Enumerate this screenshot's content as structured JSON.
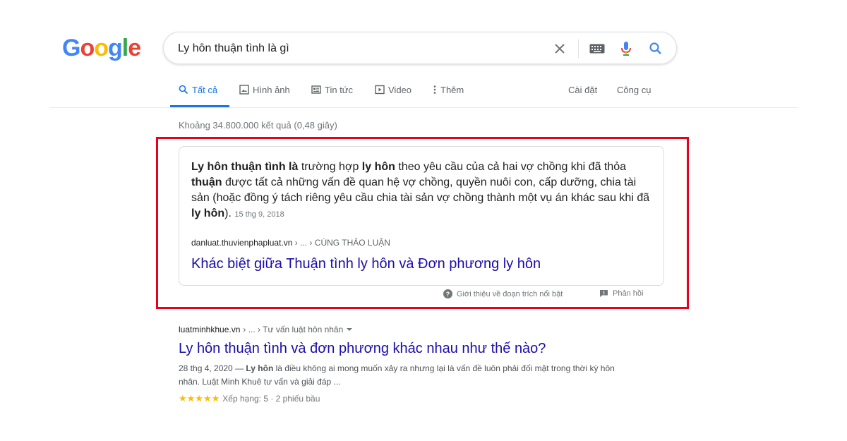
{
  "logo": {
    "letters": [
      "G",
      "o",
      "o",
      "g",
      "l",
      "e"
    ],
    "colors": [
      "#4285f4",
      "#ea4335",
      "#fbbc05",
      "#4285f4",
      "#34a853",
      "#ea4335"
    ]
  },
  "search": {
    "query": "Ly hôn thuận tình là gì",
    "icons": [
      "close-icon",
      "keyboard-icon",
      "microphone-icon",
      "search-icon"
    ]
  },
  "tabs": [
    {
      "label": "Tất cả",
      "icon": "search-icon",
      "active": true
    },
    {
      "label": "Hình ảnh",
      "icon": "image-icon",
      "active": false
    },
    {
      "label": "Tin tức",
      "icon": "news-icon",
      "active": false
    },
    {
      "label": "Video",
      "icon": "video-icon",
      "active": false
    },
    {
      "label": "Thêm",
      "icon": "more-vertical-icon",
      "active": false
    },
    {
      "label": "Cài đặt",
      "icon": "",
      "active": false
    },
    {
      "label": "Công cụ",
      "icon": "",
      "active": false
    }
  ],
  "result_stats": "Khoảng 34.800.000 kết quả (0,48 giây)",
  "featured": {
    "text_parts": [
      {
        "t": "Ly hôn thuận tình là",
        "b": true
      },
      {
        "t": " trường hợp ",
        "b": false
      },
      {
        "t": "ly hôn",
        "b": true
      },
      {
        "t": " theo yêu cầu của cả hai vợ chồng khi đã thỏa ",
        "b": false
      },
      {
        "t": "thuận",
        "b": true
      },
      {
        "t": " được tất cả những vấn đề quan hệ vợ chồng, quyền nuôi con, cấp dưỡng, chia tài sản (hoặc đồng ý tách riêng yêu cầu chia tài sản vợ chồng thành một vụ án khác sau khi đã ",
        "b": false
      },
      {
        "t": "ly hôn",
        "b": true
      },
      {
        "t": ").",
        "b": false
      }
    ],
    "date": "15 thg 9, 2018",
    "cite_domain": "danluat.thuvienphapluat.vn",
    "cite_path": " › ... › CÙNG THẢO LUẬN",
    "title": "Khác biệt giữa Thuận tình ly hôn và Đơn phương ly hôn",
    "footer_about": "Giới thiệu về đoạn trích nổi bật",
    "footer_feedback": "Phản hồi"
  },
  "result2": {
    "cite_domain": "luatminhkhue.vn",
    "cite_path": " › ... › Tư vấn luật hôn nhân",
    "title": "Ly hôn thuận tình và đơn phương khác nhau như thế nào?",
    "snippet_parts": [
      {
        "t": "28 thg 4, 2020 — ",
        "b": false
      },
      {
        "t": "Ly hôn",
        "b": true
      },
      {
        "t": " là điều không ai mong muốn xảy ra nhưng lại là vấn đề luôn phải đối mặt trong thời kỳ hôn nhân. Luật Minh Khuê tư vấn và giải đáp ...",
        "b": false
      }
    ],
    "stars": "★★★★★",
    "rating": 5,
    "rating_text": "Xếp hạng: 5 · 2 phiếu bầu"
  },
  "colors": {
    "link": "#1a0dab",
    "accent": "#1a73e8",
    "highlight_border": "#e8001c",
    "star": "#fbbc04"
  }
}
